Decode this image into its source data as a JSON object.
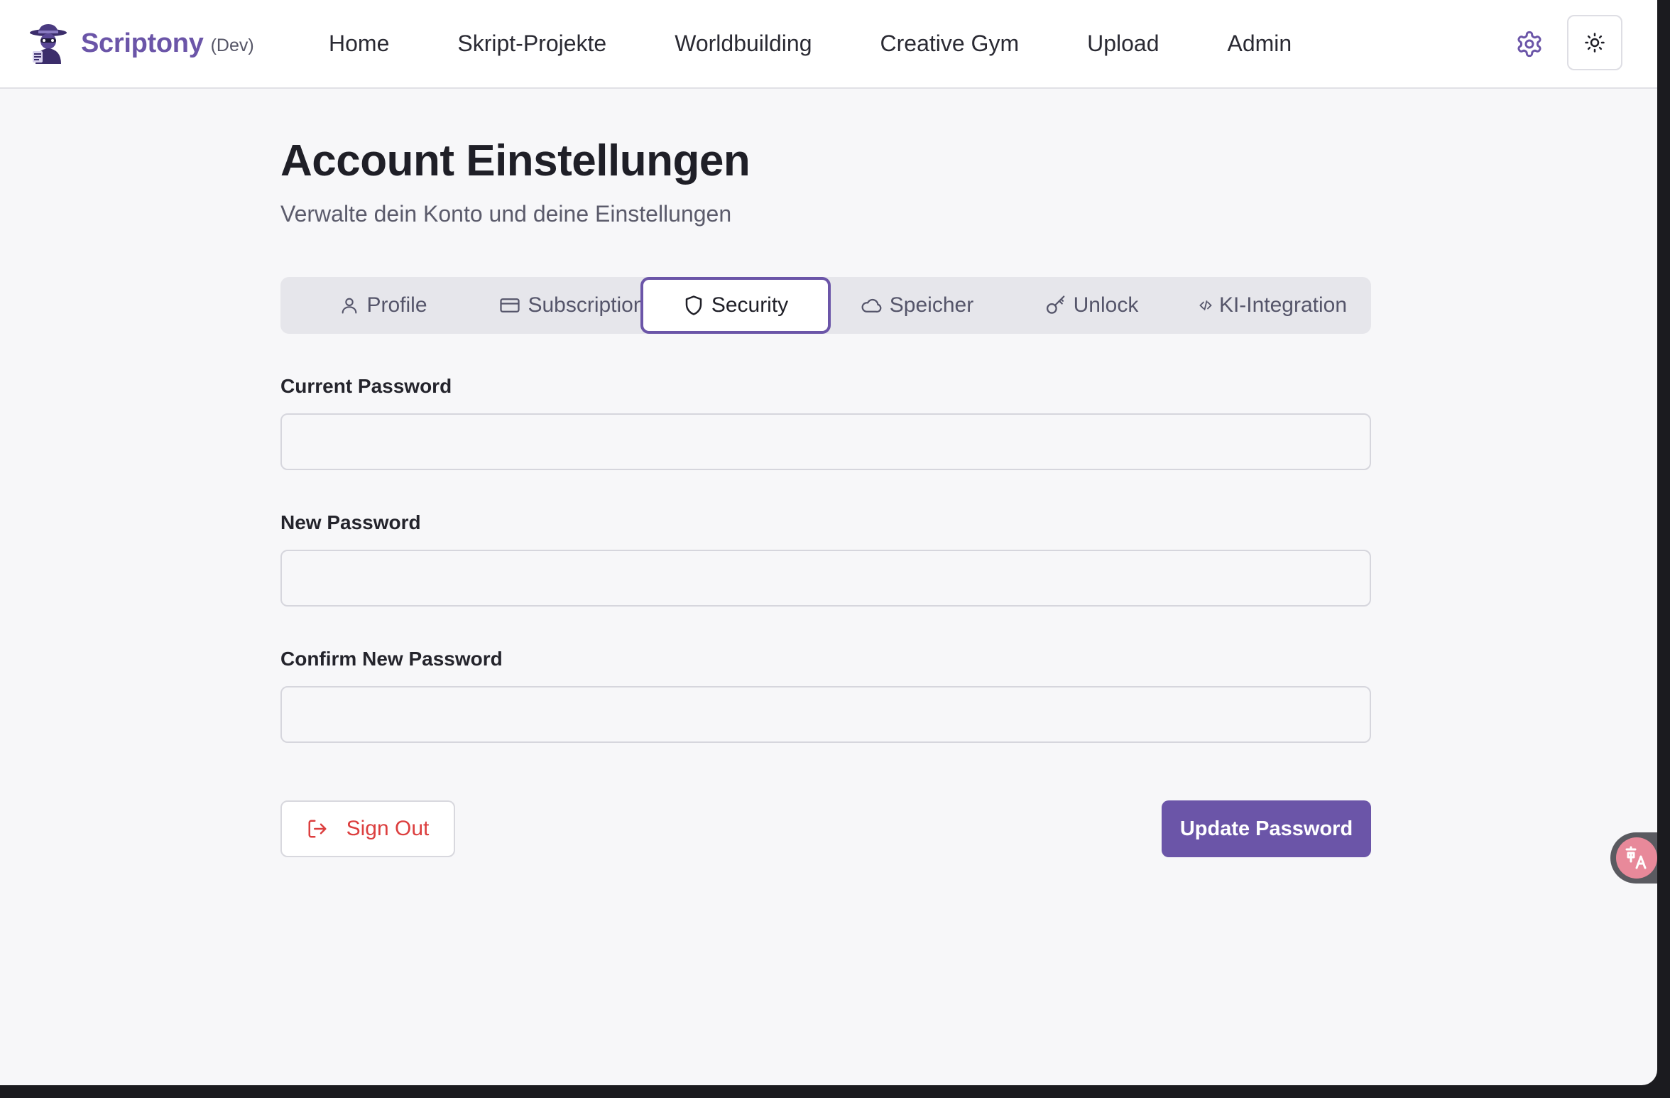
{
  "brand": {
    "name": "Scriptony",
    "env": "(Dev)",
    "accent_color": "#6b55a8",
    "logo_icon": "detective-mascot-icon"
  },
  "nav": {
    "items": [
      {
        "label": "Home"
      },
      {
        "label": "Skript-Projekte"
      },
      {
        "label": "Worldbuilding"
      },
      {
        "label": "Creative Gym"
      },
      {
        "label": "Upload"
      },
      {
        "label": "Admin"
      }
    ],
    "settings_icon": "gear-icon",
    "theme_icon": "sun-icon"
  },
  "page": {
    "title": "Account Einstellungen",
    "subtitle": "Verwalte dein Konto und deine Einstellungen"
  },
  "tabs": {
    "active": "Security",
    "items": [
      {
        "label": "Profile",
        "icon": "user-icon"
      },
      {
        "label": "Subscription",
        "icon": "credit-card-icon"
      },
      {
        "label": "Security",
        "icon": "shield-icon"
      },
      {
        "label": "Speicher",
        "icon": "cloud-icon"
      },
      {
        "label": "Unlock",
        "icon": "key-icon"
      },
      {
        "label": "KI-Integration",
        "icon": "code-icon"
      }
    ]
  },
  "form": {
    "current_password": {
      "label": "Current Password",
      "value": "",
      "placeholder": ""
    },
    "new_password": {
      "label": "New Password",
      "value": "",
      "placeholder": ""
    },
    "confirm_password": {
      "label": "Confirm New Password",
      "value": "",
      "placeholder": ""
    }
  },
  "actions": {
    "sign_out_label": "Sign Out",
    "sign_out_icon": "log-out-icon",
    "sign_out_color": "#dc3f3f",
    "update_label": "Update Password"
  },
  "overlay": {
    "translate_icon": "translate-icon",
    "translate_color": "#e8899a"
  }
}
